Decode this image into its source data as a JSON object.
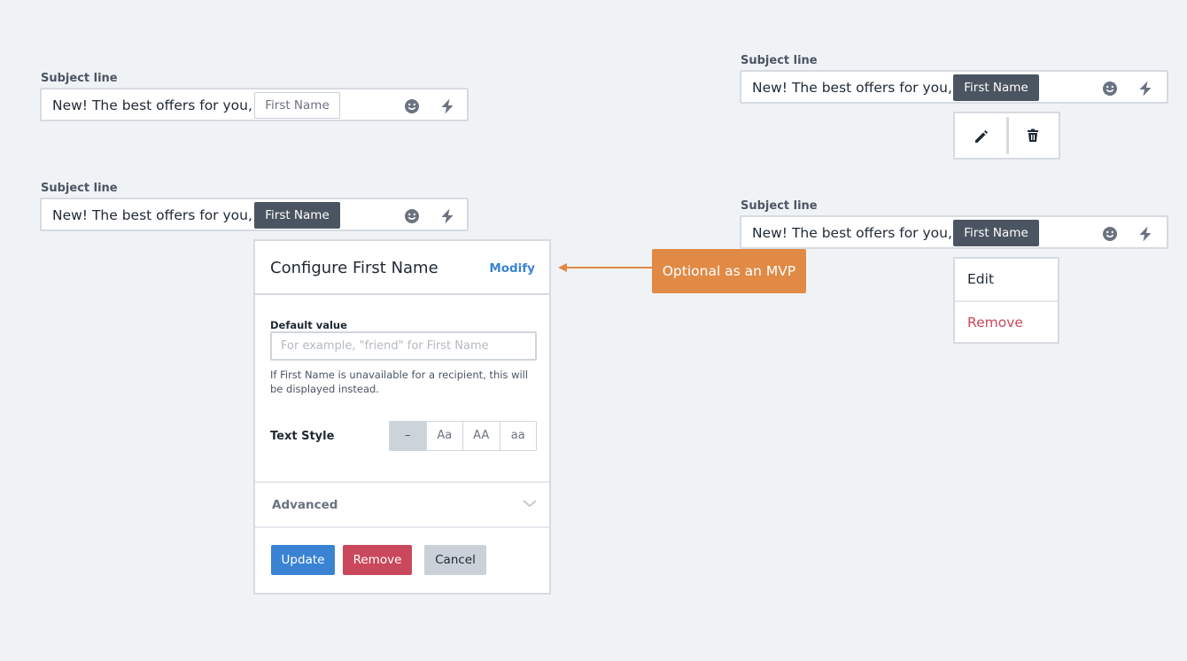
{
  "subject_label": "Subject line",
  "subject_text": "New! The best offers for you,",
  "tag_label": "First Name",
  "popover": {
    "title": "Configure First Name",
    "modify": "Modify",
    "default_label": "Default value",
    "default_placeholder": "For example, \"friend\" for First Name",
    "helper": "If First Name is unavailable for a recipient, this will be displayed instead.",
    "text_style_label": "Text Style",
    "text_style_options": [
      "–",
      "Aa",
      "AA",
      "aa"
    ],
    "advanced": "Advanced",
    "update": "Update",
    "remove": "Remove",
    "cancel": "Cancel"
  },
  "callout": "Optional as an MVP",
  "menu": {
    "edit": "Edit",
    "remove": "Remove"
  },
  "icons": [
    "emoji-icon",
    "lightning-icon",
    "pencil-icon",
    "trash-icon",
    "chevron-down-icon"
  ],
  "colors": {
    "primary": "#3a83d3",
    "danger": "#c9485b",
    "tag": "#4b5561",
    "callout": "#e08a45",
    "background": "#f0f3f6"
  }
}
